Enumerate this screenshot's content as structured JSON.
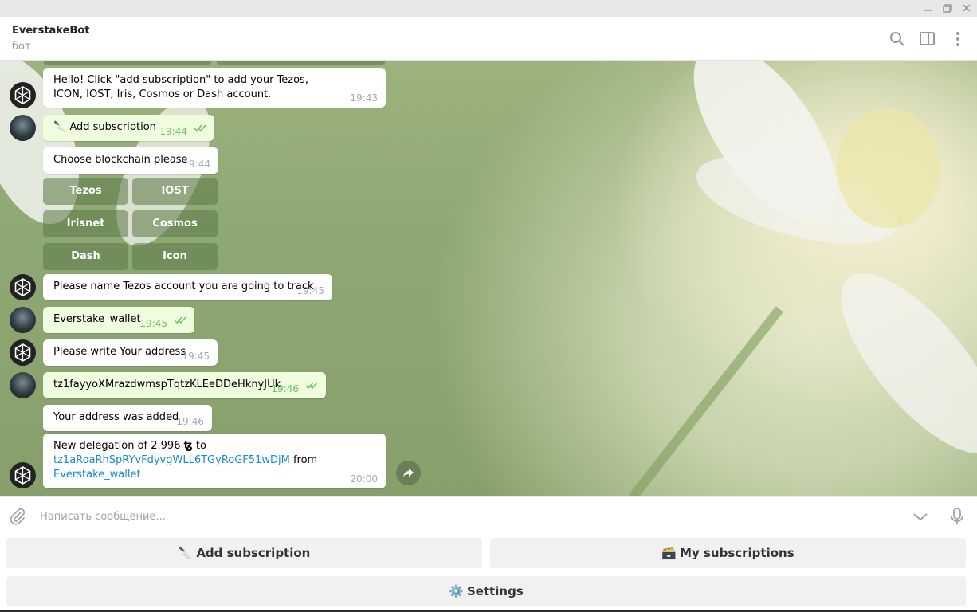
{
  "header": {
    "title": "EverstakeBot",
    "subtitle": "бот",
    "icons": [
      "search-icon",
      "sidebar-toggle-icon",
      "more-vertical-icon"
    ]
  },
  "window_controls": [
    "minimize-icon",
    "restore-icon",
    "close-icon"
  ],
  "messages": [
    {
      "from": "bot",
      "text": "Hello! Click \"add subscription\" to add your Tezos, ICON, IOST, Iris, Cosmos or Dash account.",
      "time": "19:43"
    },
    {
      "from": "user",
      "emoji": "🔪",
      "text": "Add subscription",
      "time": "19:44"
    },
    {
      "from": "bot",
      "text": "Choose blockchain please",
      "time": "19:44"
    },
    {
      "from": "bot",
      "text": "Please name Tezos account you are going to track",
      "time": "19:45"
    },
    {
      "from": "user",
      "text": "Everstake_wallet",
      "time": "19:45"
    },
    {
      "from": "bot",
      "text": "Please write Your address",
      "time": "19:45"
    },
    {
      "from": "user",
      "text": "tz1fayyoXMrazdwmspTqtzKLEeDDeHknyJUk",
      "time": "19:46"
    },
    {
      "from": "bot",
      "text": "Your address was added",
      "time": "19:46"
    },
    {
      "from": "bot",
      "text_prefix": "New delegation of 2.996",
      "currency": "ꜩ",
      "text_to": "to",
      "address": "tz1aRoaRhSpRYvFdyvgWLL6TGyRoGF51wDjM",
      "text_from": "from",
      "account": "Everstake_wallet",
      "time": "20:00"
    }
  ],
  "inline_keyboard": [
    "Tezos",
    "IOST",
    "Irisnet",
    "Cosmos",
    "Dash",
    "Icon"
  ],
  "input": {
    "placeholder": "Написать сообщение..."
  },
  "reply_keyboard": [
    {
      "emoji": "🔪",
      "label": "Add subscription"
    },
    {
      "emoji": "🗃️",
      "label": "My subscriptions"
    },
    {
      "emoji": "⚙️",
      "label": "Settings"
    }
  ]
}
